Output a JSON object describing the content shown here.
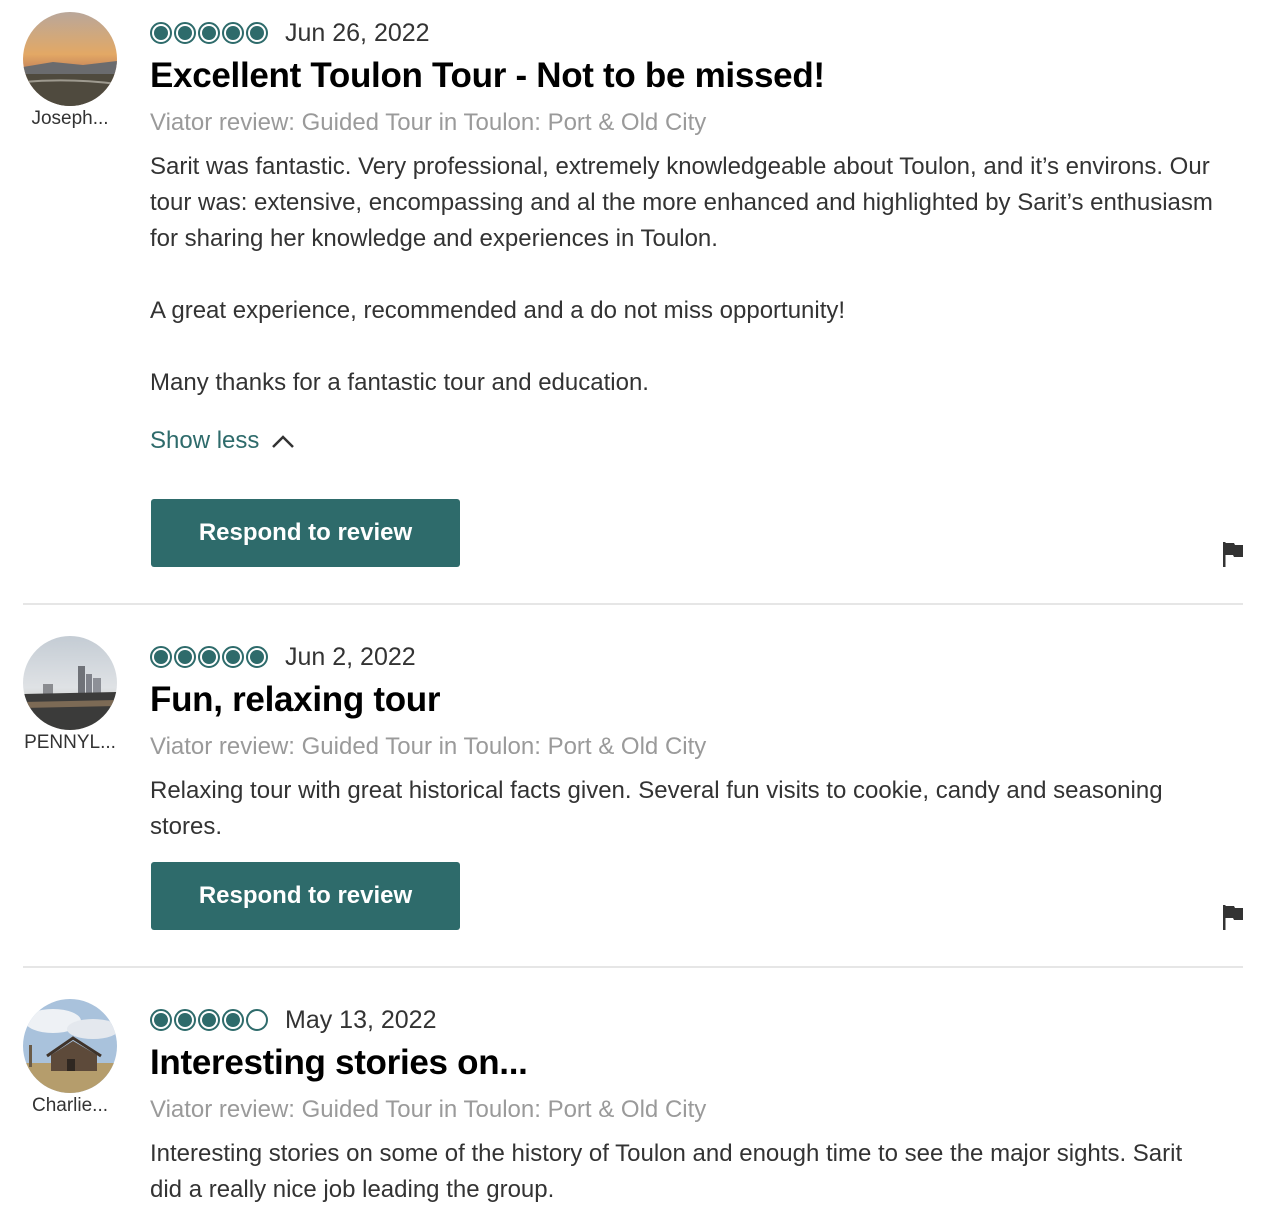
{
  "reviews": [
    {
      "user": "Joseph...",
      "rating": 5,
      "date": "Jun 26, 2022",
      "title": "Excellent Toulon Tour - Not to be missed!",
      "source": "Viator review: Guided Tour in Toulon: Port & Old City",
      "paragraphs": [
        "Sarit was fantastic. Very professional, extremely knowledgeable about Toulon, and it’s environs. Our tour was: extensive, encompassing and al the more enhanced and highlighted by Sarit’s enthusiasm for sharing her knowledge and experiences in Toulon.",
        "A great experience, recommended and a do not miss opportunity!",
        "Many thanks for a fantastic tour and education."
      ],
      "show_less": "Show less",
      "respond_label": "Respond to review"
    },
    {
      "user": "PENNYL...",
      "rating": 5,
      "date": "Jun 2, 2022",
      "title": "Fun, relaxing tour",
      "source": "Viator review: Guided Tour in Toulon: Port & Old City",
      "paragraphs": [
        "Relaxing tour with great historical facts given. Several fun visits to cookie, candy and seasoning stores."
      ],
      "respond_label": "Respond to review"
    },
    {
      "user": "Charlie...",
      "rating": 4,
      "date": "May 13, 2022",
      "title": "Interesting stories on...",
      "source": "Viator review: Guided Tour in Toulon: Port & Old City",
      "paragraphs": [
        "Interesting stories on some of the history of Toulon and enough time to see the major sights. Sarit did a really nice job leading the group."
      ]
    }
  ],
  "colors": {
    "accent": "#2e6b6b",
    "muted": "#9a9a9a",
    "divider": "#e6e6e6"
  },
  "icons": {
    "flag": "flag-icon",
    "chevron": "chevron-up-icon"
  }
}
